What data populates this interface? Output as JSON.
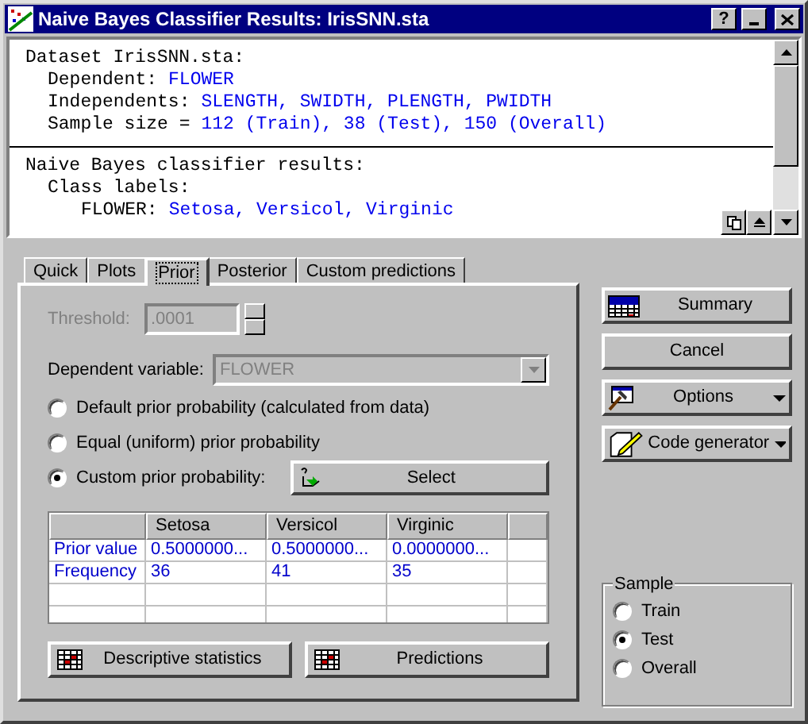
{
  "window": {
    "title": "Naive Bayes Classifier Results: IrisSNN.sta",
    "help_button": "?"
  },
  "output": [
    {
      "label": "Dataset IrisSNN.sta:",
      "children": [
        {
          "label": "Dependent:",
          "value": "FLOWER"
        },
        {
          "label": "Independents:",
          "value": "SLENGTH, SWIDTH, PLENGTH, PWIDTH"
        },
        {
          "label": "Sample size =",
          "value": "112 (Train), 38 (Test), 150 (Overall)"
        }
      ]
    },
    {
      "label": "Naive Bayes classifier results:",
      "children": [
        {
          "label": "Class labels:",
          "children": [
            {
              "label": "FLOWER:",
              "value": "Setosa, Versicol, Virginic"
            }
          ]
        }
      ]
    }
  ],
  "tabs": [
    {
      "label": "Quick",
      "selected": false
    },
    {
      "label": "Plots",
      "selected": false
    },
    {
      "label": "Prior",
      "selected": true
    },
    {
      "label": "Posterior",
      "selected": false
    },
    {
      "label": "Custom predictions",
      "selected": false
    }
  ],
  "threshold": {
    "label": "Threshold:",
    "value": ".0001",
    "disabled": true
  },
  "dependent_variable": {
    "label": "Dependent variable:",
    "value": "FLOWER",
    "disabled": true
  },
  "prior_options": [
    {
      "label": "Default prior probability (calculated from data)",
      "selected": false
    },
    {
      "label": "Equal (uniform) prior probability",
      "selected": false
    },
    {
      "label": "Custom prior probability:",
      "selected": true
    }
  ],
  "select_button": "Select",
  "table": {
    "columns": [
      "Setosa",
      "Versicol",
      "Virginic"
    ],
    "rows": [
      {
        "label": "Prior value",
        "cells": [
          "0.5000000...",
          "0.5000000...",
          "0.0000000..."
        ]
      },
      {
        "label": "Frequency",
        "cells": [
          "36",
          "41",
          "35"
        ]
      }
    ]
  },
  "bottom_buttons": [
    "Descriptive statistics",
    "Predictions"
  ],
  "side_buttons": [
    {
      "label": "Summary",
      "kind": "summary"
    },
    {
      "label": "Cancel",
      "kind": "plain"
    },
    {
      "label": "Options",
      "kind": "options"
    },
    {
      "label": "Code generator",
      "kind": "code"
    }
  ],
  "sample": {
    "title": "Sample",
    "options": [
      {
        "label": "Train",
        "selected": false
      },
      {
        "label": "Test",
        "selected": true
      },
      {
        "label": "Overall",
        "selected": false
      }
    ]
  }
}
